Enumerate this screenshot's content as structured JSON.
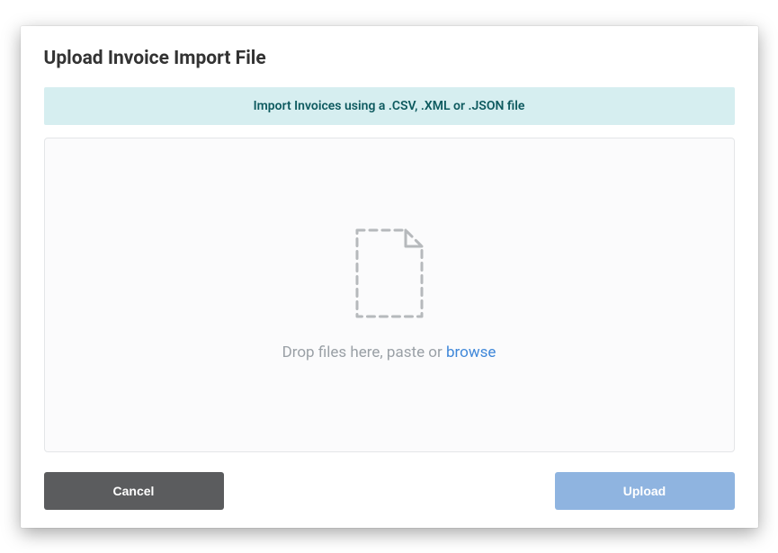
{
  "modal": {
    "title": "Upload Invoice Import File"
  },
  "banner": {
    "text": "Import Invoices using a .CSV, .XML or .JSON file"
  },
  "dropzone": {
    "prompt_prefix": "Drop files here, paste or ",
    "browse_label": "browse"
  },
  "buttons": {
    "cancel_label": "Cancel",
    "upload_label": "Upload"
  }
}
